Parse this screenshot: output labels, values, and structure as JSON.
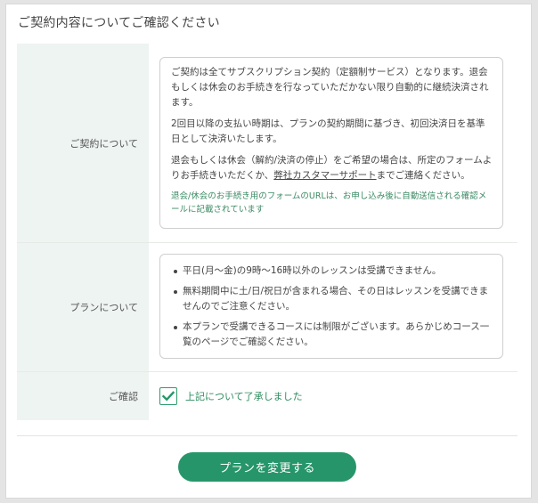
{
  "page": {
    "title": "ご契約内容についてご確認ください"
  },
  "contract": {
    "label": "ご契約について",
    "paragraph1": "ご契約は全てサブスクリプション契約（定額制サービス）となります。退会もしくは休会のお手続きを行なっていただかない限り自動的に継続決済されます。",
    "paragraph2": "2回目以降の支払い時期は、プランの契約期間に基づき、初回決済日を基準日として決済いたします。",
    "paragraph3_before": "退会もしくは休会（解約/決済の停止）をご希望の場合は、所定のフォームよりお手続きいただくか、",
    "paragraph3_link": "弊社カスタマーサポート",
    "paragraph3_after": "までご連絡ください。",
    "note": "退会/休会のお手続き用のフォームのURLは、お申し込み後に自動送信される確認メールに記載されています"
  },
  "plan": {
    "label": "プランについて",
    "items": [
      "平日(月～金)の9時～16時以外のレッスンは受講できません。",
      "無料期間中に土/日/祝日が含まれる場合、その日はレッスンを受講できませんのでご注意ください。",
      "本プランで受講できるコースには制限がございます。あらかじめコース一覧のページでご確認ください。"
    ]
  },
  "confirm": {
    "label": "ご確認",
    "checkbox_label": "上記について了承しました",
    "checked": true
  },
  "submit": {
    "label": "プランを変更する"
  },
  "colors": {
    "accent": "#26966a",
    "label_bg": "#eef4f1",
    "note_text": "#3b8a64"
  }
}
